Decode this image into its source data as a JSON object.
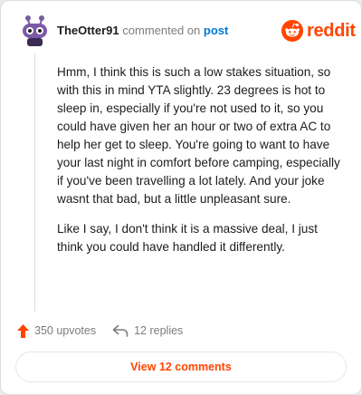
{
  "header": {
    "username": "TheOtter91",
    "commented_text": "commented on",
    "post_link": "post",
    "brand_name": "reddit"
  },
  "comment": {
    "paragraphs": [
      "Hmm, I think this is such a low stakes situation, so with this in mind YTA slightly. 23 degrees is hot to sleep in, especially if you're not used to it, so you could have given her an hour or two of extra AC to help her get to sleep. You're going to want to have your last night in comfort before camping, especially if you've been travelling a lot lately. And your joke wasnt that bad, but a little unpleasant sure.",
      "Like I say, I don't think it is a massive deal, I just think you could have handled it differently."
    ]
  },
  "actions": {
    "upvotes": "350 upvotes",
    "replies": "12 replies"
  },
  "footer": {
    "view_comments": "View 12 comments"
  },
  "colors": {
    "brand": "#ff4500",
    "link": "#0079d3",
    "avatar": "#7a5aa6"
  },
  "icons": {
    "avatar": "snoo-avatar-icon",
    "logo": "reddit-snoo-icon",
    "upvote": "upvote-arrow-icon",
    "reply": "reply-arrow-icon"
  }
}
